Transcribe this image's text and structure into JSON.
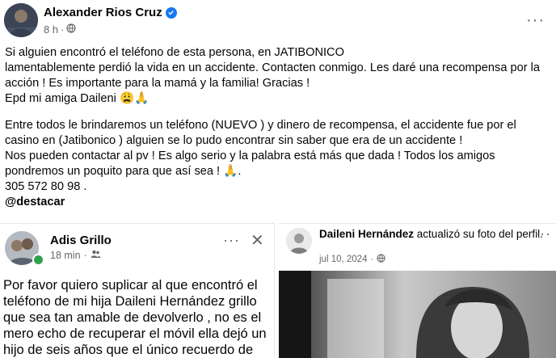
{
  "post": {
    "author": "Alexander Rios Cruz",
    "time": "8 h",
    "separator": "·",
    "more_label": "···",
    "paragraph1": "Si alguien encontró el teléfono de esta persona, en JATIBONICO\nlamentablemente perdió la vida en un accidente. Contacten conmigo. Les daré una recompensa por la\nacción ! Es importante para la mamá y la familia! Gracias !\nEpd mi amiga Daileni 😩🙏",
    "paragraph2": "Entre todos le brindaremos un teléfono (NUEVO ) y dinero de recompensa, el accidente fue por el\ncasino en  (Jatibonico ) alguien se lo pudo encontrar sin saber que era de un accidente !\nNos  pueden contactar al pv ! Es algo serio y la palabra está más que dada ! Todos los amigos\npondremos un poquito para que así sea ! 🙏.\n305 572 80 98 .",
    "tag": "@destacar"
  },
  "left_card": {
    "author": "Adis Grillo",
    "time": "18 min",
    "separator": "·",
    "more_label": "···",
    "close_label": "✕",
    "body": "Por favor quiero suplicar al que encontró el\nteléfono de mi hija Daileni Hernández grillo\nque sea tan amable de devolverlo , no es el\nmero echo de recuperar el móvil ella dejó un\nhijo de seis años que el único recuerdo de su"
  },
  "right_card": {
    "author": "Daileni Hernández",
    "action": "actualizó su foto del perfil.",
    "date": "jul 10, 2024",
    "separator": "·",
    "more_label": "···"
  },
  "colors": {
    "verified": "#1877f2",
    "online": "#31a24c",
    "meta_text": "#65676b"
  },
  "icons": [
    "verified-badge-icon",
    "globe-icon",
    "friends-icon",
    "more-icon",
    "close-icon"
  ]
}
